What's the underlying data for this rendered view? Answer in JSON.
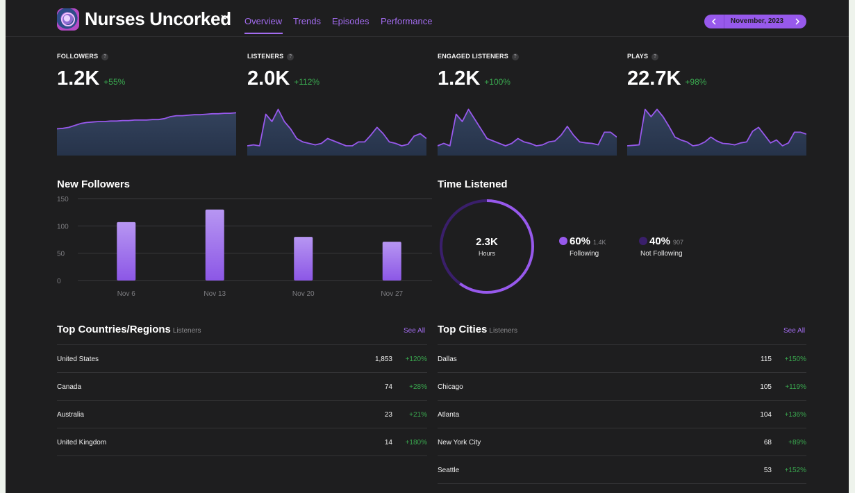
{
  "header": {
    "show_title": "Nurses Uncorked",
    "tabs": [
      "Overview",
      "Trends",
      "Episodes",
      "Performance"
    ],
    "active_tab": "Overview",
    "date": "November, 2023"
  },
  "stats": [
    {
      "label": "FOLLOWERS",
      "value": "1.2K",
      "change": "+55%"
    },
    {
      "label": "LISTENERS",
      "value": "2.0K",
      "change": "+112%"
    },
    {
      "label": "ENGAGED LISTENERS",
      "value": "1.2K",
      "change": "+100%"
    },
    {
      "label": "PLAYS",
      "value": "22.7K",
      "change": "+98%"
    }
  ],
  "sparklines": {
    "followers": [
      0.55,
      0.56,
      0.58,
      0.62,
      0.66,
      0.68,
      0.69,
      0.7,
      0.7,
      0.71,
      0.71,
      0.72,
      0.72,
      0.73,
      0.73,
      0.73,
      0.74,
      0.74,
      0.76,
      0.8,
      0.82,
      0.82,
      0.83,
      0.84,
      0.84,
      0.85,
      0.86,
      0.86,
      0.87,
      0.87,
      0.88
    ],
    "listeners": [
      0.2,
      0.22,
      0.2,
      0.85,
      0.7,
      0.95,
      0.7,
      0.55,
      0.35,
      0.28,
      0.25,
      0.22,
      0.25,
      0.35,
      0.3,
      0.25,
      0.2,
      0.2,
      0.28,
      0.28,
      0.42,
      0.58,
      0.45,
      0.28,
      0.25,
      0.2,
      0.23,
      0.4,
      0.45,
      0.35
    ],
    "engaged": [
      0.2,
      0.25,
      0.2,
      0.85,
      0.7,
      0.95,
      0.75,
      0.55,
      0.35,
      0.3,
      0.25,
      0.2,
      0.25,
      0.35,
      0.28,
      0.25,
      0.2,
      0.22,
      0.28,
      0.3,
      0.42,
      0.6,
      0.42,
      0.28,
      0.26,
      0.25,
      0.22,
      0.48,
      0.48,
      0.38
    ],
    "plays": [
      0.2,
      0.21,
      0.22,
      0.95,
      0.8,
      0.95,
      0.8,
      0.6,
      0.38,
      0.32,
      0.28,
      0.2,
      0.22,
      0.28,
      0.38,
      0.3,
      0.25,
      0.24,
      0.22,
      0.26,
      0.28,
      0.5,
      0.58,
      0.42,
      0.26,
      0.32,
      0.2,
      0.26,
      0.48,
      0.48,
      0.44
    ]
  },
  "new_followers": {
    "title": "New Followers",
    "chart_data": {
      "type": "bar",
      "categories": [
        "Nov 6",
        "Nov 13",
        "Nov 20",
        "Nov 27"
      ],
      "values": [
        107,
        130,
        80,
        71
      ],
      "ylim": [
        0,
        150
      ],
      "yticks": [
        "0",
        "50",
        "100",
        "150"
      ],
      "grid": true
    }
  },
  "time_listened": {
    "title": "Time Listened",
    "total": "2.3K",
    "unit": "Hours",
    "chart_data": {
      "type": "pie",
      "categories": [
        "Following",
        "Not Following"
      ],
      "values": [
        60,
        40
      ]
    },
    "segments": [
      {
        "pct": "60%",
        "count": "1.4K",
        "name": "Following",
        "color": "#9759ec"
      },
      {
        "pct": "40%",
        "count": "907",
        "name": "Not Following",
        "color": "#3a1f6b"
      }
    ]
  },
  "countries": {
    "title": "Top Countries/Regions",
    "subtitle": "Listeners",
    "see_all": "See All",
    "rows": [
      {
        "name": "United States",
        "value": "1,853",
        "change": "+120%"
      },
      {
        "name": "Canada",
        "value": "74",
        "change": "+28%"
      },
      {
        "name": "Australia",
        "value": "23",
        "change": "+21%"
      },
      {
        "name": "United Kingdom",
        "value": "14",
        "change": "+180%"
      }
    ]
  },
  "cities": {
    "title": "Top Cities",
    "subtitle": "Listeners",
    "see_all": "See All",
    "rows": [
      {
        "name": "Dallas",
        "value": "115",
        "change": "+150%"
      },
      {
        "name": "Chicago",
        "value": "105",
        "change": "+119%"
      },
      {
        "name": "Atlanta",
        "value": "104",
        "change": "+136%"
      },
      {
        "name": "New York City",
        "value": "68",
        "change": "+89%"
      },
      {
        "name": "Seattle",
        "value": "53",
        "change": "+152%"
      }
    ]
  },
  "colors": {
    "accent": "#9759ec",
    "positive": "#3aa84f",
    "background": "#1e1e1f"
  }
}
